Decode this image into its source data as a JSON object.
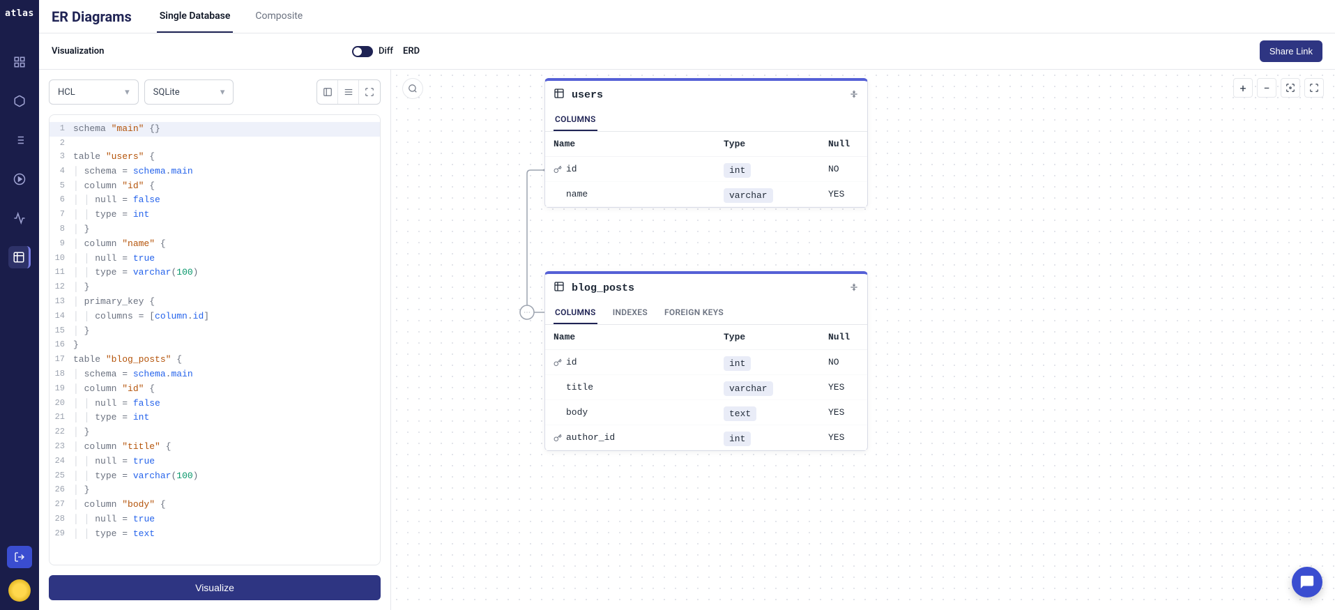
{
  "brand": "atlas",
  "page_title": "ER Diagrams",
  "top_tabs": [
    "Single Database",
    "Composite"
  ],
  "top_tab_active": 0,
  "subheader": {
    "left_label": "Visualization",
    "diff_label": "Diff",
    "right_label": "ERD",
    "share_label": "Share Link"
  },
  "dropdowns": {
    "lang": "HCL",
    "db": "SQLite"
  },
  "visualize_label": "Visualize",
  "code_lines": [
    {
      "n": 1,
      "sel": true,
      "t": [
        [
          "kw",
          "schema "
        ],
        [
          "str",
          "\"main\""
        ],
        [
          "punc",
          " {}"
        ]
      ]
    },
    {
      "n": 2,
      "t": []
    },
    {
      "n": 3,
      "t": [
        [
          "kw",
          "table "
        ],
        [
          "str",
          "\"users\""
        ],
        [
          "punc",
          " {"
        ]
      ]
    },
    {
      "n": 4,
      "t": [
        [
          "g",
          "  "
        ],
        [
          "attr",
          "schema "
        ],
        [
          "punc",
          "= "
        ],
        [
          "val",
          "schema"
        ],
        [
          "punc",
          "."
        ],
        [
          "val",
          "main"
        ]
      ]
    },
    {
      "n": 5,
      "t": [
        [
          "g",
          "  "
        ],
        [
          "kw",
          "column "
        ],
        [
          "str",
          "\"id\""
        ],
        [
          "punc",
          " {"
        ]
      ]
    },
    {
      "n": 6,
      "t": [
        [
          "g",
          "    "
        ],
        [
          "attr",
          "null "
        ],
        [
          "punc",
          "= "
        ],
        [
          "val",
          "false"
        ]
      ]
    },
    {
      "n": 7,
      "t": [
        [
          "g",
          "    "
        ],
        [
          "attr",
          "type "
        ],
        [
          "punc",
          "= "
        ],
        [
          "val",
          "int"
        ]
      ]
    },
    {
      "n": 8,
      "t": [
        [
          "g",
          "  "
        ],
        [
          "punc",
          "}"
        ]
      ]
    },
    {
      "n": 9,
      "t": [
        [
          "g",
          "  "
        ],
        [
          "kw",
          "column "
        ],
        [
          "str",
          "\"name\""
        ],
        [
          "punc",
          " {"
        ]
      ]
    },
    {
      "n": 10,
      "t": [
        [
          "g",
          "    "
        ],
        [
          "attr",
          "null "
        ],
        [
          "punc",
          "= "
        ],
        [
          "val",
          "true"
        ]
      ]
    },
    {
      "n": 11,
      "t": [
        [
          "g",
          "    "
        ],
        [
          "attr",
          "type "
        ],
        [
          "punc",
          "= "
        ],
        [
          "val",
          "varchar"
        ],
        [
          "punc",
          "("
        ],
        [
          "num",
          "100"
        ],
        [
          "punc",
          ")"
        ]
      ]
    },
    {
      "n": 12,
      "t": [
        [
          "g",
          "  "
        ],
        [
          "punc",
          "}"
        ]
      ]
    },
    {
      "n": 13,
      "t": [
        [
          "g",
          "  "
        ],
        [
          "kw",
          "primary_key "
        ],
        [
          "punc",
          "{"
        ]
      ]
    },
    {
      "n": 14,
      "t": [
        [
          "g",
          "    "
        ],
        [
          "attr",
          "columns "
        ],
        [
          "punc",
          "= ["
        ],
        [
          "val",
          "column"
        ],
        [
          "punc",
          "."
        ],
        [
          "val",
          "id"
        ],
        [
          "punc",
          "]"
        ]
      ]
    },
    {
      "n": 15,
      "t": [
        [
          "g",
          "  "
        ],
        [
          "punc",
          "}"
        ]
      ]
    },
    {
      "n": 16,
      "t": [
        [
          "punc",
          "}"
        ]
      ]
    },
    {
      "n": 17,
      "t": [
        [
          "kw",
          "table "
        ],
        [
          "str",
          "\"blog_posts\""
        ],
        [
          "punc",
          " {"
        ]
      ]
    },
    {
      "n": 18,
      "t": [
        [
          "g",
          "  "
        ],
        [
          "attr",
          "schema "
        ],
        [
          "punc",
          "= "
        ],
        [
          "val",
          "schema"
        ],
        [
          "punc",
          "."
        ],
        [
          "val",
          "main"
        ]
      ]
    },
    {
      "n": 19,
      "t": [
        [
          "g",
          "  "
        ],
        [
          "kw",
          "column "
        ],
        [
          "str",
          "\"id\""
        ],
        [
          "punc",
          " {"
        ]
      ]
    },
    {
      "n": 20,
      "t": [
        [
          "g",
          "    "
        ],
        [
          "attr",
          "null "
        ],
        [
          "punc",
          "= "
        ],
        [
          "val",
          "false"
        ]
      ]
    },
    {
      "n": 21,
      "t": [
        [
          "g",
          "    "
        ],
        [
          "attr",
          "type "
        ],
        [
          "punc",
          "= "
        ],
        [
          "val",
          "int"
        ]
      ]
    },
    {
      "n": 22,
      "t": [
        [
          "g",
          "  "
        ],
        [
          "punc",
          "}"
        ]
      ]
    },
    {
      "n": 23,
      "t": [
        [
          "g",
          "  "
        ],
        [
          "kw",
          "column "
        ],
        [
          "str",
          "\"title\""
        ],
        [
          "punc",
          " {"
        ]
      ]
    },
    {
      "n": 24,
      "t": [
        [
          "g",
          "    "
        ],
        [
          "attr",
          "null "
        ],
        [
          "punc",
          "= "
        ],
        [
          "val",
          "true"
        ]
      ]
    },
    {
      "n": 25,
      "t": [
        [
          "g",
          "    "
        ],
        [
          "attr",
          "type "
        ],
        [
          "punc",
          "= "
        ],
        [
          "val",
          "varchar"
        ],
        [
          "punc",
          "("
        ],
        [
          "num",
          "100"
        ],
        [
          "punc",
          ")"
        ]
      ]
    },
    {
      "n": 26,
      "t": [
        [
          "g",
          "  "
        ],
        [
          "punc",
          "}"
        ]
      ]
    },
    {
      "n": 27,
      "t": [
        [
          "g",
          "  "
        ],
        [
          "kw",
          "column "
        ],
        [
          "str",
          "\"body\""
        ],
        [
          "punc",
          " {"
        ]
      ]
    },
    {
      "n": 28,
      "t": [
        [
          "g",
          "    "
        ],
        [
          "attr",
          "null "
        ],
        [
          "punc",
          "= "
        ],
        [
          "val",
          "true"
        ]
      ]
    },
    {
      "n": 29,
      "t": [
        [
          "g",
          "    "
        ],
        [
          "attr",
          "type "
        ],
        [
          "punc",
          "= "
        ],
        [
          "val",
          "text"
        ]
      ]
    }
  ],
  "entities": {
    "users": {
      "name": "users",
      "tabs": [
        "COLUMNS"
      ],
      "active_tab": 0,
      "headers": {
        "name": "Name",
        "type": "Type",
        "null": "Null"
      },
      "cols": [
        {
          "key": true,
          "name": "id",
          "type": "int",
          "null": "NO"
        },
        {
          "key": false,
          "name": "name",
          "type": "varchar",
          "null": "YES"
        }
      ]
    },
    "blog_posts": {
      "name": "blog_posts",
      "tabs": [
        "COLUMNS",
        "INDEXES",
        "FOREIGN KEYS"
      ],
      "active_tab": 0,
      "headers": {
        "name": "Name",
        "type": "Type",
        "null": "Null"
      },
      "cols": [
        {
          "key": true,
          "name": "id",
          "type": "int",
          "null": "NO"
        },
        {
          "key": false,
          "name": "title",
          "type": "varchar",
          "null": "YES"
        },
        {
          "key": false,
          "name": "body",
          "type": "text",
          "null": "YES"
        },
        {
          "key": true,
          "name": "author_id",
          "type": "int",
          "null": "YES"
        }
      ]
    }
  }
}
